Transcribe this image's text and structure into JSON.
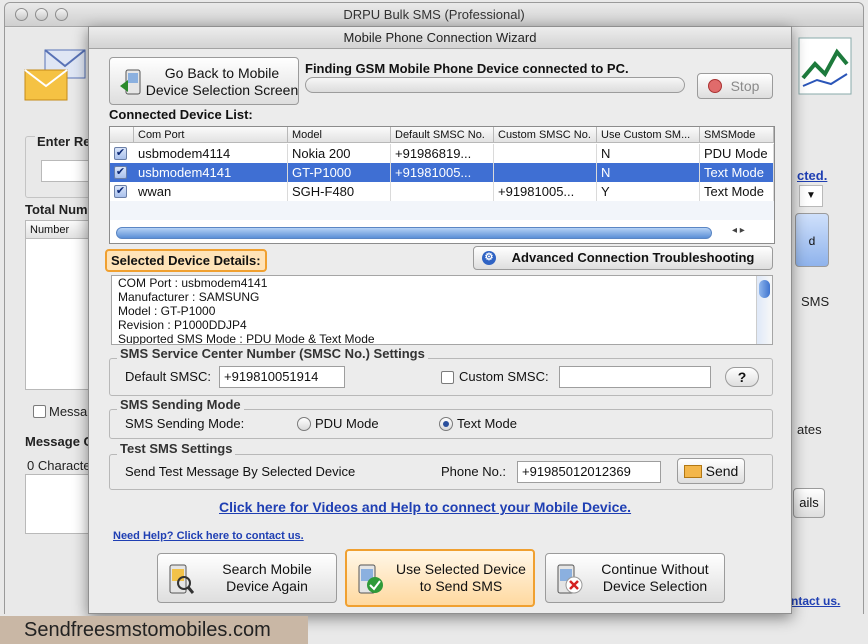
{
  "main_window": {
    "title": "DRPU Bulk SMS (Professional)",
    "enter_label": "Enter Rec",
    "total_label": "Total Num",
    "number_header": "Number",
    "message_checkbox_label": "Messa",
    "message_label": "Message C",
    "char_count": "0 Characte",
    "link_fragment": "cted.",
    "right_button_fragment": "d",
    "sms_label": "SMS",
    "tes_label": "ates",
    "ails_label": "ails",
    "contact_fragment": "ntact us."
  },
  "wizard": {
    "title": "Mobile Phone Connection Wizard",
    "go_back_label_line1": "Go Back to Mobile",
    "go_back_label_line2": "Device Selection Screen",
    "finding_text": "Finding GSM Mobile Phone Device connected to PC.",
    "stop_label": "Stop",
    "connected_list_label": "Connected Device List:",
    "table": {
      "headers": [
        "Com Port",
        "Model",
        "Default SMSC No.",
        "Custom SMSC No.",
        "Use Custom SM...",
        "SMSMode"
      ],
      "rows": [
        {
          "checked": true,
          "com_port": "usbmodem4114",
          "model": "Nokia 200",
          "default_smsc": "+91986819...",
          "custom_smsc": "",
          "use_custom": "N",
          "sms_mode": "PDU Mode"
        },
        {
          "checked": true,
          "com_port": "usbmodem4141",
          "model": "GT-P1000",
          "default_smsc": "+91981005...",
          "custom_smsc": "",
          "use_custom": "N",
          "sms_mode": "Text Mode"
        },
        {
          "checked": true,
          "com_port": "wwan",
          "model": "SGH-F480",
          "default_smsc": "",
          "custom_smsc": "+91981005...",
          "use_custom": "Y",
          "sms_mode": "Text Mode"
        }
      ]
    },
    "advanced_button": "Advanced Connection Troubleshooting",
    "selected_details_label": "Selected Device Details:",
    "details_lines": [
      "COM Port : usbmodem4141",
      "Manufacturer : SAMSUNG",
      "Model : GT-P1000",
      "Revision : P1000DDJP4",
      "Supported SMS Mode : PDU Mode & Text Mode"
    ],
    "smsc_group": {
      "legend": "SMS Service Center Number (SMSC No.) Settings",
      "default_label": "Default SMSC:",
      "default_value": "+919810051914",
      "custom_label": "Custom SMSC:",
      "custom_value": "",
      "help_label": "?"
    },
    "mode_group": {
      "legend": "SMS Sending Mode",
      "label": "SMS Sending Mode:",
      "pdu_label": "PDU Mode",
      "text_label": "Text Mode",
      "selected": "text"
    },
    "test_group": {
      "legend": "Test SMS Settings",
      "send_label": "Send Test Message By Selected Device",
      "phone_label": "Phone No.:",
      "phone_value": "+919850120123​69",
      "send_button": "Send"
    },
    "help_link": "Click here for Videos and Help to connect your Mobile Device.",
    "need_help_link": "Need Help? Click here to contact us.",
    "search_button_line1": "Search Mobile",
    "search_button_line2": "Device Again",
    "use_button_line1": "Use Selected Device",
    "use_button_line2": "to Send SMS",
    "continue_button_line1": "Continue Without",
    "continue_button_line2": "Device Selection"
  },
  "footer": {
    "site": "Sendfreesmstomobiles.com"
  },
  "colors": {
    "selection": "#3f6fd3",
    "accent_orange": "#f0a030",
    "link_blue": "#1f3fb3"
  }
}
